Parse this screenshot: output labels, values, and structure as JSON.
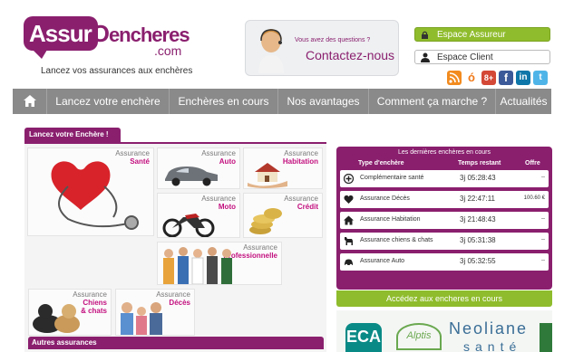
{
  "header": {
    "logo": {
      "part1": "Assur",
      "part2": "O",
      "part3": "encheres",
      "com": ".com"
    },
    "tagline": "Lancez vos assurances aux enchères",
    "contact": {
      "question": "Vous avez des questions ?",
      "cta": "Contactez-nous"
    },
    "espace_assureur": "Espace Assureur",
    "espace_client": "Espace Client",
    "social": [
      {
        "name": "rss",
        "glyph": "Ω",
        "color": "#f28b1f"
      },
      {
        "name": "viadeo",
        "glyph": "o",
        "color": "#f07a1a"
      },
      {
        "name": "google-plus",
        "glyph": "8+",
        "color": "#d34836"
      },
      {
        "name": "facebook",
        "glyph": "f",
        "color": "#3b5998"
      },
      {
        "name": "linkedin",
        "glyph": "in",
        "color": "#0e76a8"
      },
      {
        "name": "twitter",
        "glyph": "t",
        "color": "#4fb5e8"
      }
    ]
  },
  "nav": {
    "items": [
      "Lancez votre enchère",
      "Enchères en cours",
      "Nos avantages",
      "Comment ça marche ?",
      "Actualités"
    ]
  },
  "left": {
    "tab_title": "Lancez votre Enchère !",
    "kind_label": "Assurance",
    "tiles": {
      "sante": "Santé",
      "auto": "Auto",
      "habitation": "Habitation",
      "moto": "Moto",
      "credit": "Crédit",
      "pro": "Professionnelle",
      "chiens": "Chiens\n& chats",
      "deces": "Décès"
    },
    "autres": "Autres assurances"
  },
  "right": {
    "title": "Les dernières enchères en cours",
    "headers": {
      "type": "Type d'enchère",
      "time": "Temps restant",
      "offer": "Offre"
    },
    "rows": [
      {
        "icon": "plus-circle-icon",
        "type": "Complémentaire santé",
        "time": "3j 05:28:43",
        "offer": "--"
      },
      {
        "icon": "heart-icon",
        "type": "Assurance Décès",
        "time": "3j 22:47:11",
        "offer": "100.60 €"
      },
      {
        "icon": "house-icon",
        "type": "Assurance Habitation",
        "time": "3j 21:48:43",
        "offer": "--"
      },
      {
        "icon": "dog-icon",
        "type": "Assurance chiens & chats",
        "time": "3j 05:31:38",
        "offer": "--"
      },
      {
        "icon": "car-icon",
        "type": "Assurance Auto",
        "time": "3j 05:32:55",
        "offer": "--"
      }
    ],
    "access": "Accédez aux encheres en cours",
    "partners": {
      "eca": "ECA",
      "alptis": "Alptis",
      "neo1": "Neoliane",
      "neo2": "santé"
    }
  }
}
